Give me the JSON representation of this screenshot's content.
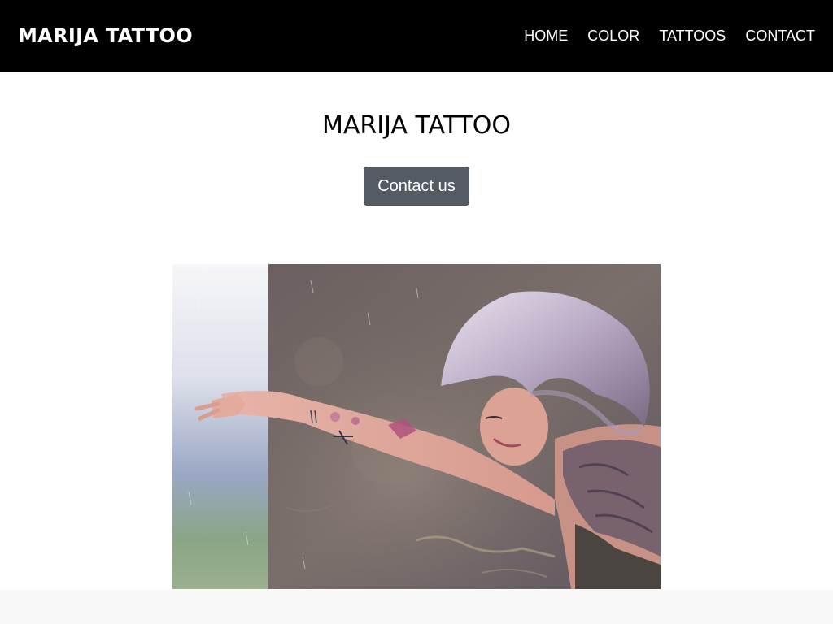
{
  "navbar": {
    "brand": "MARIJA TATTOO",
    "links": [
      {
        "label": "HOME"
      },
      {
        "label": "COLOR"
      },
      {
        "label": "TATTOOS"
      },
      {
        "label": "CONTACT"
      }
    ],
    "background": "#000000",
    "text_color": "#ffffff"
  },
  "hero": {
    "title": "MARIJA TATTOO",
    "button_label": "Contact us",
    "button_color": "#545b62",
    "image_icon": "tattooed-woman-photo"
  },
  "footer": {
    "background": "#f8f8f8"
  }
}
